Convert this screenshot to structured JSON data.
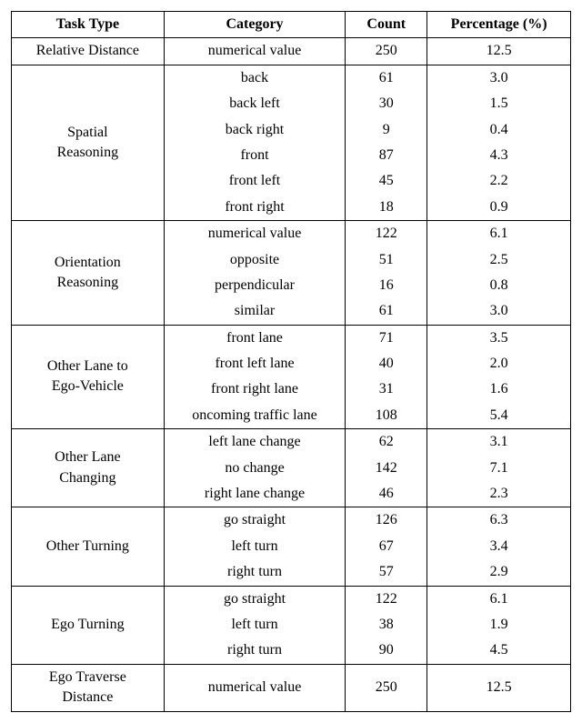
{
  "chart_data": {
    "type": "table",
    "title": "",
    "columns": [
      "Task Type",
      "Category",
      "Count",
      "Percentage (%)"
    ],
    "rows": [
      {
        "task_type": "Relative Distance",
        "category": "numerical value",
        "count": 250,
        "percentage": 12.5
      },
      {
        "task_type": "Spatial Reasoning",
        "category": "back",
        "count": 61,
        "percentage": 3.0
      },
      {
        "task_type": "Spatial Reasoning",
        "category": "back left",
        "count": 30,
        "percentage": 1.5
      },
      {
        "task_type": "Spatial Reasoning",
        "category": "back right",
        "count": 9,
        "percentage": 0.4
      },
      {
        "task_type": "Spatial Reasoning",
        "category": "front",
        "count": 87,
        "percentage": 4.3
      },
      {
        "task_type": "Spatial Reasoning",
        "category": "front left",
        "count": 45,
        "percentage": 2.2
      },
      {
        "task_type": "Spatial Reasoning",
        "category": "front right",
        "count": 18,
        "percentage": 0.9
      },
      {
        "task_type": "Orientation Reasoning",
        "category": "numerical value",
        "count": 122,
        "percentage": 6.1
      },
      {
        "task_type": "Orientation Reasoning",
        "category": "opposite",
        "count": 51,
        "percentage": 2.5
      },
      {
        "task_type": "Orientation Reasoning",
        "category": "perpendicular",
        "count": 16,
        "percentage": 0.8
      },
      {
        "task_type": "Orientation Reasoning",
        "category": "similar",
        "count": 61,
        "percentage": 3.0
      },
      {
        "task_type": "Other Lane to Ego-Vehicle",
        "category": "front lane",
        "count": 71,
        "percentage": 3.5
      },
      {
        "task_type": "Other Lane to Ego-Vehicle",
        "category": "front left lane",
        "count": 40,
        "percentage": 2.0
      },
      {
        "task_type": "Other Lane to Ego-Vehicle",
        "category": "front right lane",
        "count": 31,
        "percentage": 1.6
      },
      {
        "task_type": "Other Lane to Ego-Vehicle",
        "category": "oncoming traffic lane",
        "count": 108,
        "percentage": 5.4
      },
      {
        "task_type": "Other Lane Changing",
        "category": "left lane change",
        "count": 62,
        "percentage": 3.1
      },
      {
        "task_type": "Other Lane Changing",
        "category": "no change",
        "count": 142,
        "percentage": 7.1
      },
      {
        "task_type": "Other Lane Changing",
        "category": "right lane change",
        "count": 46,
        "percentage": 2.3
      },
      {
        "task_type": "Other Turning",
        "category": "go straight",
        "count": 126,
        "percentage": 6.3
      },
      {
        "task_type": "Other Turning",
        "category": "left turn",
        "count": 67,
        "percentage": 3.4
      },
      {
        "task_type": "Other Turning",
        "category": "right turn",
        "count": 57,
        "percentage": 2.9
      },
      {
        "task_type": "Ego Turning",
        "category": "go straight",
        "count": 122,
        "percentage": 6.1
      },
      {
        "task_type": "Ego Turning",
        "category": "left turn",
        "count": 38,
        "percentage": 1.9
      },
      {
        "task_type": "Ego Turning",
        "category": "right turn",
        "count": 90,
        "percentage": 4.5
      },
      {
        "task_type": "Ego Traverse Distance",
        "category": "numerical value",
        "count": 250,
        "percentage": 12.5
      }
    ]
  },
  "headers": {
    "task_type": "Task Type",
    "category": "Category",
    "count": "Count",
    "percentage": "Percentage (%)"
  },
  "groups": [
    {
      "task_type_lines": [
        "Relative Distance"
      ],
      "rows": [
        {
          "category": "numerical value",
          "count": "250",
          "percentage": "12.5"
        }
      ]
    },
    {
      "task_type_lines": [
        "Spatial",
        "Reasoning"
      ],
      "rows": [
        {
          "category": "back",
          "count": "61",
          "percentage": "3.0"
        },
        {
          "category": "back left",
          "count": "30",
          "percentage": "1.5"
        },
        {
          "category": "back right",
          "count": "9",
          "percentage": "0.4"
        },
        {
          "category": "front",
          "count": "87",
          "percentage": "4.3"
        },
        {
          "category": "front left",
          "count": "45",
          "percentage": "2.2"
        },
        {
          "category": "front right",
          "count": "18",
          "percentage": "0.9"
        }
      ]
    },
    {
      "task_type_lines": [
        "Orientation",
        "Reasoning"
      ],
      "rows": [
        {
          "category": "numerical value",
          "count": "122",
          "percentage": "6.1"
        },
        {
          "category": "opposite",
          "count": "51",
          "percentage": "2.5"
        },
        {
          "category": "perpendicular",
          "count": "16",
          "percentage": "0.8"
        },
        {
          "category": "similar",
          "count": "61",
          "percentage": "3.0"
        }
      ]
    },
    {
      "task_type_lines": [
        "Other Lane to",
        "Ego-Vehicle"
      ],
      "rows": [
        {
          "category": "front lane",
          "count": "71",
          "percentage": "3.5"
        },
        {
          "category": "front left lane",
          "count": "40",
          "percentage": "2.0"
        },
        {
          "category": "front right lane",
          "count": "31",
          "percentage": "1.6"
        },
        {
          "category": "oncoming traffic lane",
          "count": "108",
          "percentage": "5.4"
        }
      ]
    },
    {
      "task_type_lines": [
        "Other Lane",
        "Changing"
      ],
      "rows": [
        {
          "category": "left lane change",
          "count": "62",
          "percentage": "3.1"
        },
        {
          "category": "no change",
          "count": "142",
          "percentage": "7.1"
        },
        {
          "category": "right lane change",
          "count": "46",
          "percentage": "2.3"
        }
      ]
    },
    {
      "task_type_lines": [
        "Other Turning"
      ],
      "rows": [
        {
          "category": "go straight",
          "count": "126",
          "percentage": "6.3"
        },
        {
          "category": "left turn",
          "count": "67",
          "percentage": "3.4"
        },
        {
          "category": "right turn",
          "count": "57",
          "percentage": "2.9"
        }
      ]
    },
    {
      "task_type_lines": [
        "Ego Turning"
      ],
      "rows": [
        {
          "category": "go straight",
          "count": "122",
          "percentage": "6.1"
        },
        {
          "category": "left turn",
          "count": "38",
          "percentage": "1.9"
        },
        {
          "category": "right turn",
          "count": "90",
          "percentage": "4.5"
        }
      ]
    },
    {
      "task_type_lines": [
        "Ego Traverse",
        "Distance"
      ],
      "rows": [
        {
          "category": "numerical value",
          "count": "250",
          "percentage": "12.5"
        }
      ]
    }
  ]
}
